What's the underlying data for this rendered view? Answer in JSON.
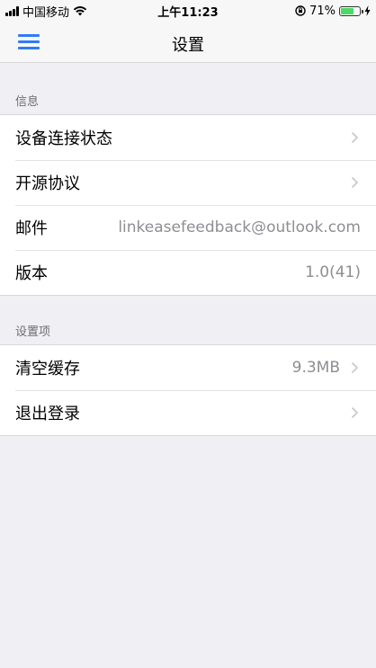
{
  "status_bar": {
    "carrier": "中国移动",
    "time": "上午11:23",
    "battery_percent": "71%",
    "battery_level": 0.71
  },
  "nav": {
    "title": "设置",
    "menu_icon": "hamburger-menu-icon"
  },
  "sections": [
    {
      "header": "信息",
      "rows": [
        {
          "label": "设备连接状态",
          "value": "",
          "chevron": true
        },
        {
          "label": "开源协议",
          "value": "",
          "chevron": true
        },
        {
          "label": "邮件",
          "value": "linkeasefeedback@outlook.com",
          "chevron": false
        },
        {
          "label": "版本",
          "value": "1.0(41)",
          "chevron": false
        }
      ]
    },
    {
      "header": "设置项",
      "rows": [
        {
          "label": "清空缓存",
          "value": "9.3MB",
          "chevron": true
        },
        {
          "label": "退出登录",
          "value": "",
          "chevron": true
        }
      ]
    }
  ],
  "colors": {
    "accent": "#2f7cf6",
    "background": "#efeff4",
    "secondary_text": "#8e8e93",
    "battery_green": "#4cd964"
  }
}
